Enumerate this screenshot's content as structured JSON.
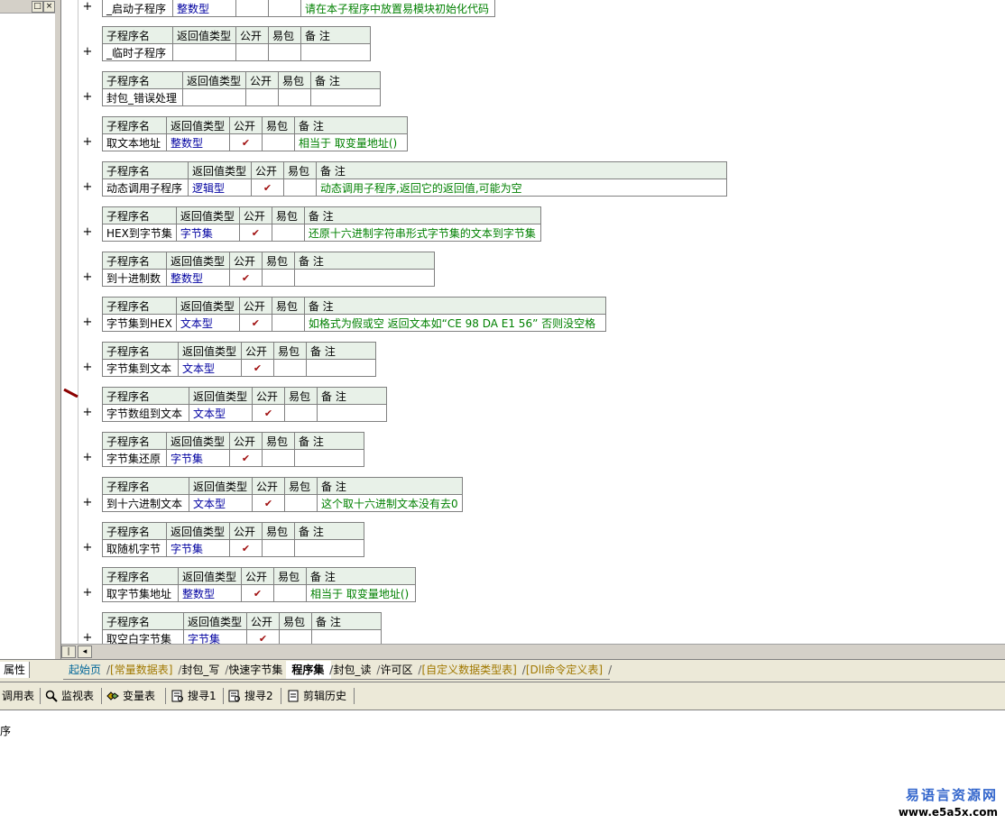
{
  "headers": {
    "name": "子程序名",
    "ret": "返回值类型",
    "pub": "公开",
    "easy": "易包",
    "note": "备 注"
  },
  "check_mark": "✔",
  "plus": "+",
  "first_row": {
    "name": "_启动子程序",
    "type": "整数型",
    "pub": "",
    "note": "请在本子程序中放置易模块初始化代码"
  },
  "subs": [
    {
      "name": "_临时子程序",
      "type": "",
      "pub": "",
      "note": ""
    },
    {
      "name": "封包_错误处理",
      "type": "",
      "pub": "",
      "note": ""
    },
    {
      "name": "取文本地址",
      "type": "整数型",
      "pub": "✔",
      "note": "相当于 取变量地址()"
    },
    {
      "name": "动态调用子程序",
      "type": "逻辑型",
      "pub": "✔",
      "note": "动态调用子程序,返回它的返回值,可能为空"
    },
    {
      "name": "HEX到字节集",
      "type": "字节集",
      "pub": "✔",
      "note": "还原十六进制字符串形式字节集的文本到字节集"
    },
    {
      "name": "到十进制数",
      "type": "整数型",
      "pub": "✔",
      "note": ""
    },
    {
      "name": "字节集到HEX",
      "type": "文本型",
      "pub": "✔",
      "note": "如格式为假或空 返回文本如“CE 98 DA E1 56” 否则没空格"
    },
    {
      "name": "字节集到文本",
      "type": "文本型",
      "pub": "✔",
      "note": ""
    },
    {
      "name": "字节数组到文本",
      "type": "文本型",
      "pub": "✔",
      "note": ""
    },
    {
      "name": "字节集还原",
      "type": "字节集",
      "pub": "✔",
      "note": ""
    },
    {
      "name": "到十六进制文本",
      "type": "文本型",
      "pub": "✔",
      "note": "这个取十六进制文本没有去0"
    },
    {
      "name": "取随机字节",
      "type": "字节集",
      "pub": "✔",
      "note": ""
    },
    {
      "name": "取字节集地址",
      "type": "整数型",
      "pub": "✔",
      "note": "相当于 取变量地址()"
    },
    {
      "name": "取空白字节集",
      "type": "字节集",
      "pub": "✔",
      "note": ""
    }
  ],
  "prop_tab": "属性",
  "tabs": [
    {
      "label": "起始页",
      "style": "blue"
    },
    {
      "label": "[常量数据表]",
      "style": "olive"
    },
    {
      "label": "封包_写",
      "style": ""
    },
    {
      "label": "快速字节集",
      "style": ""
    },
    {
      "label": "程序集",
      "style": "active"
    },
    {
      "label": "封包_读",
      "style": ""
    },
    {
      "label": "许可区",
      "style": ""
    },
    {
      "label": "[自定义数据类型表]",
      "style": "olive"
    },
    {
      "label": "[Dll命令定义表]",
      "style": "olive"
    }
  ],
  "toolbar": {
    "call_table": "调用表",
    "monitor": "监视表",
    "variable": "变量表",
    "search1": "搜寻1",
    "search2": "搜寻2",
    "clip_history": "剪辑历史"
  },
  "output_text": "序",
  "watermark": {
    "name": "易语言资源网",
    "url": "www.e5a5x.com"
  },
  "window_buttons": {
    "restore": "□",
    "close": "×"
  }
}
